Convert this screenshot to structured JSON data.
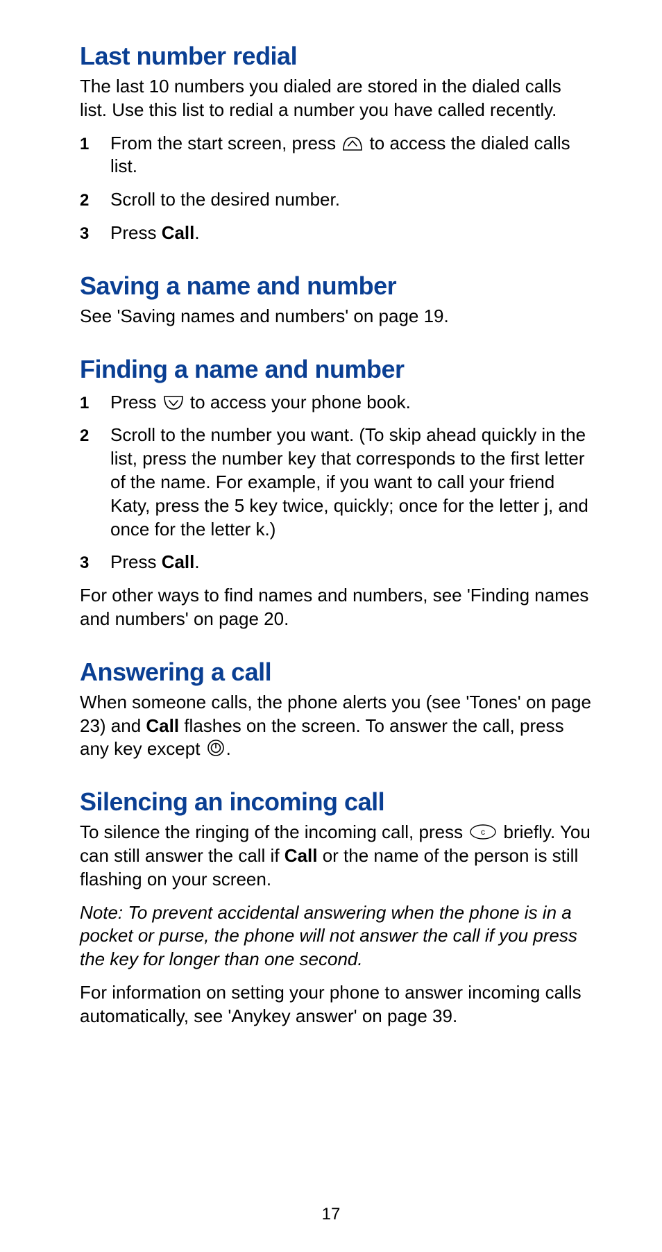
{
  "pageNumber": "17",
  "sections": {
    "redial": {
      "heading": "Last number redial",
      "intro": "The last 10 numbers you dialed are stored in the dialed calls list. Use this list to redial a number you have called recently.",
      "step1_a": "From the start screen, press ",
      "step1_b": " to access the dialed calls list.",
      "step2": "Scroll to the desired number.",
      "step3_a": "Press ",
      "step3_bold": "Call",
      "step3_b": "."
    },
    "saving": {
      "heading": "Saving a name and number",
      "body": "See 'Saving names and numbers' on page 19."
    },
    "finding": {
      "heading": "Finding a name and number",
      "step1_a": "Press ",
      "step1_b": " to access your phone book.",
      "step2": "Scroll to the number you want. (To skip ahead quickly in the list, press the number key that corresponds to the first letter of the name. For example, if you want to call your friend Katy, press the 5 key twice, quickly; once for the letter j, and once for the letter k.)",
      "step3_a": "Press ",
      "step3_bold": "Call",
      "step3_b": ".",
      "after": "For other ways to find names and numbers, see 'Finding names and numbers' on page 20."
    },
    "answering": {
      "heading": "Answering a call",
      "body_a": "When someone calls, the phone alerts you (see 'Tones' on page 23) and ",
      "body_bold": "Call",
      "body_b": " flashes on the screen. To answer the call, press any key except ",
      "body_c": "."
    },
    "silencing": {
      "heading": "Silencing an incoming call",
      "body_a": "To silence the ringing of the incoming call, press ",
      "body_b": " briefly. You can still answer the call if ",
      "body_bold": "Call",
      "body_c": " or the name of the person is still flashing on your screen.",
      "note": "Note:  To prevent accidental answering when the phone is in a pocket or purse, the phone will not answer the call if you press the key for longer than one second.",
      "after": "For information on setting your phone to answer incoming calls automatically, see 'Anykey answer' on page 39."
    }
  }
}
